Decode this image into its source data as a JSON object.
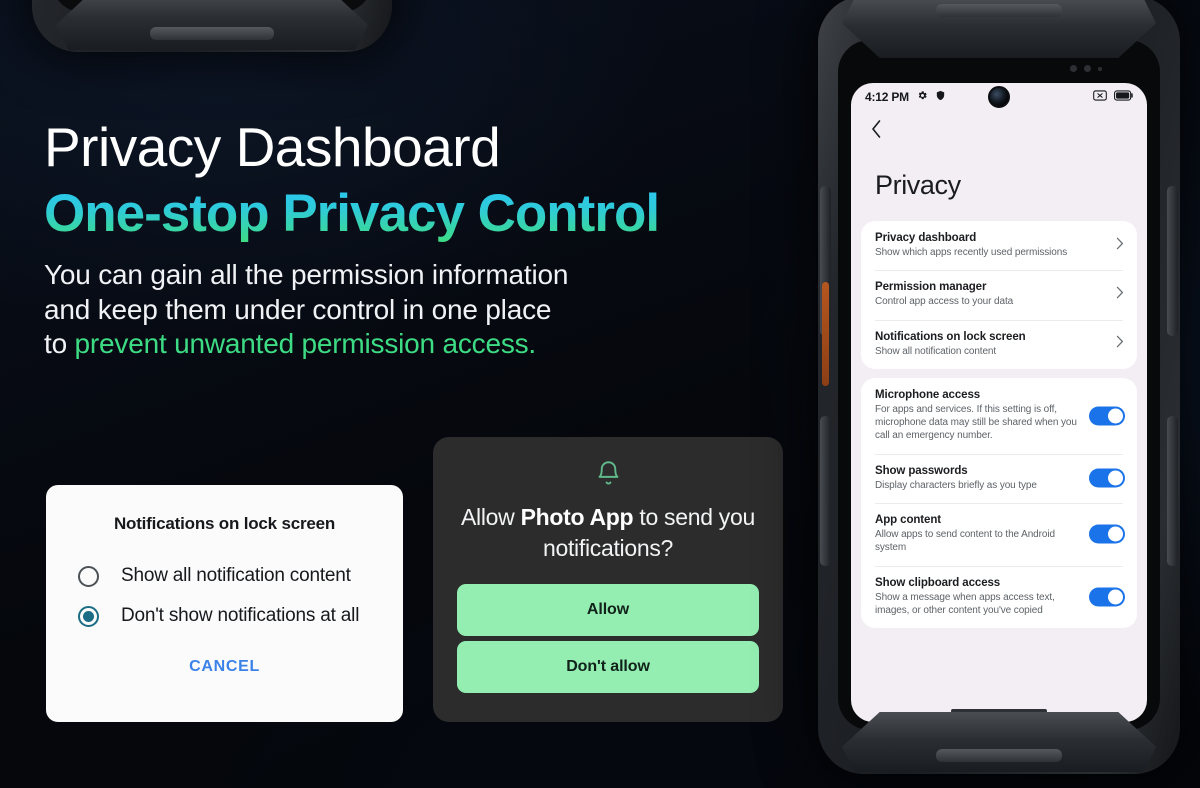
{
  "hero": {
    "headline": "Privacy Dashboard",
    "subhead": "One-stop Privacy Control",
    "body_line1": "You can gain all the permission information",
    "body_line2": "and keep them under control in one place",
    "body_line3_prefix": "to ",
    "body_line3_accent": "prevent unwanted permission access.",
    "accent_color": "#3ddc84",
    "gradient_from": "#29c6f2",
    "gradient_to": "#3ddc84"
  },
  "radio_dialog": {
    "title": "Notifications on lock screen",
    "options": [
      {
        "label": "Show all notification content",
        "selected": false
      },
      {
        "label": "Don't show notifications at all",
        "selected": true
      }
    ],
    "cancel_label": "CANCEL",
    "cancel_color": "#3b82e8",
    "selected_color": "#1a6d85"
  },
  "permission_dialog": {
    "icon": "bell-icon",
    "question_prefix": "Allow ",
    "app_name": "Photo App",
    "question_suffix": " to send you notifications?",
    "allow_label": "Allow",
    "deny_label": "Don't allow",
    "button_color": "#94eeb2",
    "surface_color": "#2c2c2c"
  },
  "phone": {
    "statusbar": {
      "time": "4:12 PM",
      "left_icons": [
        "gear-icon",
        "shield-icon"
      ],
      "right_icons": [
        "no-sim-icon",
        "battery-icon"
      ]
    },
    "nav_back": "back-chevron-icon",
    "page_title": "Privacy",
    "nav_cards": [
      {
        "title": "Privacy dashboard",
        "subtitle": "Show which apps recently used permissions",
        "chevron": "chevron-right-icon"
      },
      {
        "title": "Permission manager",
        "subtitle": "Control app access to your data",
        "chevron": "chevron-right-icon"
      },
      {
        "title": "Notifications on lock screen",
        "subtitle": "Show all notification content",
        "chevron": "chevron-right-icon"
      }
    ],
    "toggle_cards": [
      {
        "title": "Microphone access",
        "subtitle": "For apps and services. If this setting is off, microphone data may still be shared when you call an emergency number.",
        "enabled": true
      },
      {
        "title": "Show passwords",
        "subtitle": "Display characters briefly as you type",
        "enabled": true
      },
      {
        "title": "App content",
        "subtitle": "Allow apps to send content to the Android system",
        "enabled": true
      },
      {
        "title": "Show clipboard access",
        "subtitle": "Show a message when apps access text, images, or other content you've copied",
        "enabled": true
      }
    ],
    "toggle_on_color": "#1a73e8"
  }
}
